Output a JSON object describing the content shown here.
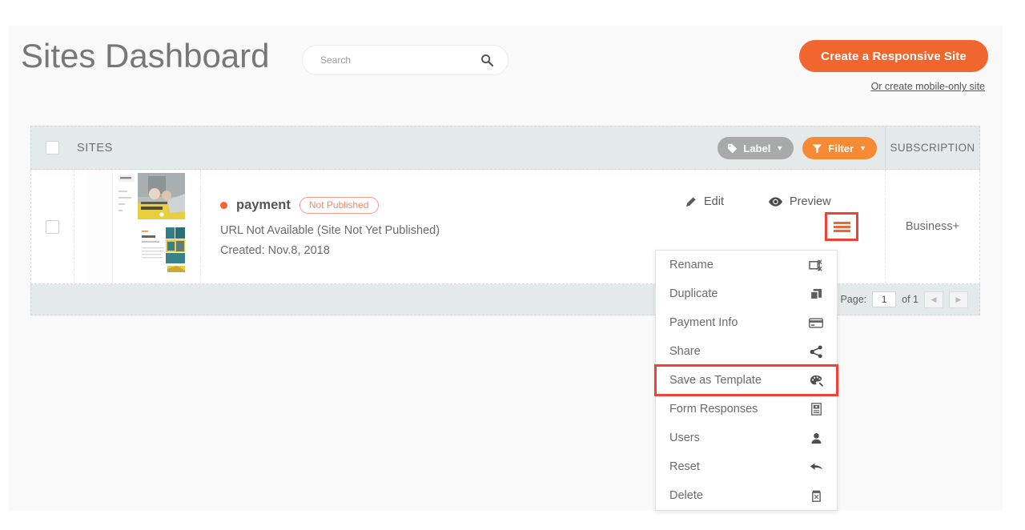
{
  "header": {
    "title": "Sites Dashboard",
    "search_placeholder": "Search",
    "search_value": "",
    "search_icon": "search-icon",
    "cta_label": "Create a Responsive Site",
    "cta_sub_label": "Or create mobile-only site",
    "accent_color": "#f1662f"
  },
  "table": {
    "header": {
      "sites_label": "SITES",
      "label_button": "Label",
      "filter_button": "Filter",
      "subscription_label": "SUBSCRIPTION",
      "label_button_color": "#a8aaaa",
      "filter_button_color": "#f78a34"
    },
    "rows": [
      {
        "name": "payment",
        "status_badge": "Not Published",
        "status_dot_color": "#f1662f",
        "url": "URL Not Available (Site Not Yet Published)",
        "created": "Created: Nov.8, 2018",
        "subscription": "Business+",
        "actions": {
          "edit": "Edit",
          "preview": "Preview",
          "menu_icon": "hamburger-menu-icon"
        }
      }
    ],
    "footer": {
      "page_label": "Page:",
      "page_value": "1",
      "of_label": "of 1",
      "prev_label": "◀",
      "next_label": "▶"
    }
  },
  "context_menu": {
    "highlighted": "Save as Template",
    "highlight_color": "#ef4136",
    "items": [
      {
        "label": "Rename",
        "icon": "rename-icon"
      },
      {
        "label": "Duplicate",
        "icon": "duplicate-icon"
      },
      {
        "label": "Payment Info",
        "icon": "credit-card-icon"
      },
      {
        "label": "Share",
        "icon": "share-icon"
      },
      {
        "label": "Save as Template",
        "icon": "palette-icon"
      },
      {
        "label": "Form Responses",
        "icon": "form-icon"
      },
      {
        "label": "Users",
        "icon": "user-icon"
      },
      {
        "label": "Reset",
        "icon": "undo-arrow-icon"
      },
      {
        "label": "Delete",
        "icon": "trash-icon"
      }
    ]
  }
}
